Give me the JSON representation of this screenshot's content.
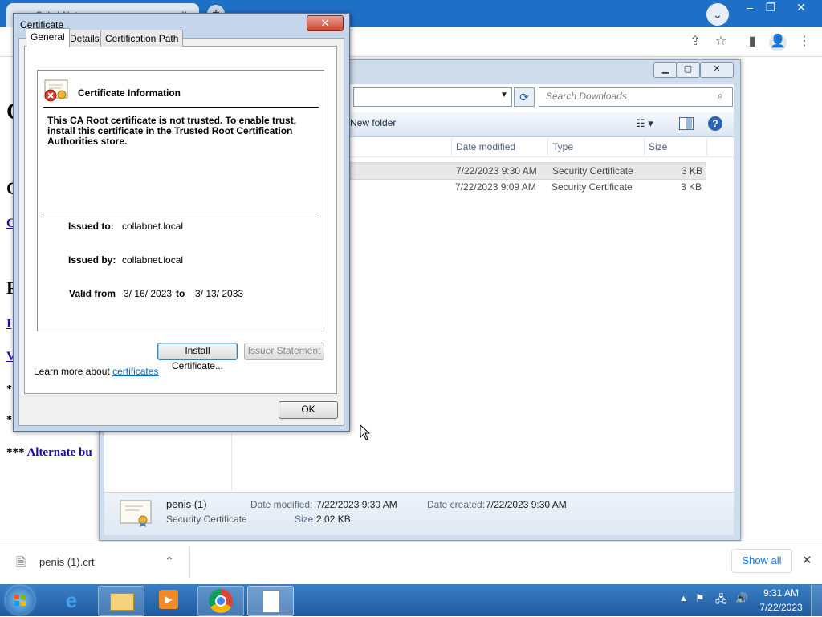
{
  "browser": {
    "tab_title": "CollabNet",
    "tab_close": "×",
    "new_tab": "+",
    "window_controls": {
      "minimize": "–",
      "maximize": "❐",
      "close": "✕"
    },
    "toolbar_icons": [
      "share-icon",
      "star-icon",
      "sidebar-icon",
      "profile-icon",
      "menu-icon"
    ]
  },
  "page": {
    "fragments": [
      "C",
      "C",
      "C",
      "P",
      "I",
      "V",
      "*",
      "*"
    ],
    "alternate_prefix": "***",
    "alternate_link": "Alternate bu"
  },
  "explorer": {
    "search_placeholder": "Search Downloads",
    "new_folder": "New folder",
    "columns": {
      "date": "Date modified",
      "type": "Type",
      "size": "Size"
    },
    "files": [
      {
        "date": "7/22/2023 9:30 AM",
        "type": "Security Certificate",
        "size": "3 KB"
      },
      {
        "date": "7/22/2023 9:09 AM",
        "type": "Security Certificate",
        "size": "3 KB"
      }
    ],
    "details": {
      "name": "penis (1)",
      "type": "Security Certificate",
      "modified_label": "Date modified:",
      "modified_value": "7/22/2023 9:30 AM",
      "created_label": "Date created:",
      "created_value": "7/22/2023 9:30 AM",
      "size_label": "Size:",
      "size_value": "2.02 KB"
    }
  },
  "certificate": {
    "title": "Certificate",
    "tabs": [
      "General",
      "Details",
      "Certification Path"
    ],
    "info_heading": "Certificate Information",
    "warning": "This CA Root certificate is not trusted. To enable trust, install this certificate in the Trusted Root Certification Authorities store.",
    "issued_to_label": "Issued to:",
    "issued_to": "collabnet.local",
    "issued_by_label": "Issued by:",
    "issued_by": "collabnet.local",
    "valid_from_label": "Valid from",
    "valid_from": "3/ 16/ 2023",
    "to_label": "to",
    "valid_to": "3/ 13/ 2033",
    "install_button": "Install Certificate...",
    "issuer_button": "Issuer Statement",
    "learn_more_prefix": "Learn more about",
    "learn_more_link": "certificates",
    "ok_button": "OK"
  },
  "download_bar": {
    "file_name": "penis (1).crt",
    "show_all": "Show all"
  },
  "taskbar": {
    "time": "9:31 AM",
    "date": "7/22/2023"
  }
}
